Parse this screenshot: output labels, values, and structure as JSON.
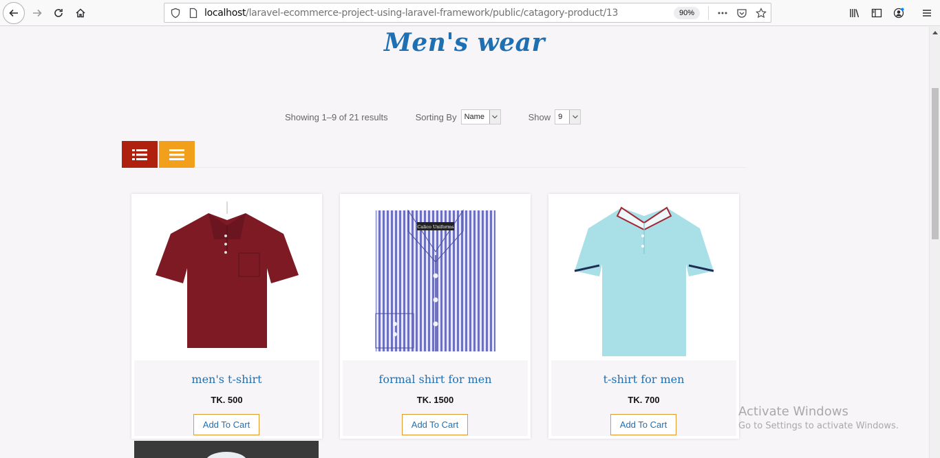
{
  "browser": {
    "url_host": "localhost",
    "url_path": "/laravel-ecommerce-project-using-laravel-framework/public/catagory-product/13",
    "zoom": "90%",
    "icons": [
      "back-icon",
      "forward-icon",
      "reload-icon",
      "home-icon",
      "shield-icon",
      "page-icon",
      "more-icon",
      "pocket-icon",
      "star-icon",
      "library-icon",
      "sidebar-icon",
      "account-icon",
      "menu-icon"
    ]
  },
  "page": {
    "title": "Men's wear",
    "results_text": "Showing 1–9 of 21 results",
    "sort_label": "Sorting By",
    "sort_value": "Name",
    "show_label": "Show",
    "show_value": "9"
  },
  "products": [
    {
      "name": "men's t-shirt",
      "price": "TK. 500",
      "cart_label": "Add To Cart",
      "color": "#7d1a24",
      "image": "polo-shirt-maroon"
    },
    {
      "name": "formal shirt for men",
      "price": "TK. 1500",
      "cart_label": "Add To Cart",
      "color": "#6d6fbf",
      "image": "striped-formal-shirt",
      "label_text": "Calico Uniforms"
    },
    {
      "name": "t-shirt for men",
      "price": "TK. 700",
      "cart_label": "Add To Cart",
      "color": "#a9e0e8",
      "image": "polo-shirt-lightblue"
    }
  ],
  "watermark": {
    "title": "Activate Windows",
    "subtitle": "Go to Settings to activate Windows."
  }
}
